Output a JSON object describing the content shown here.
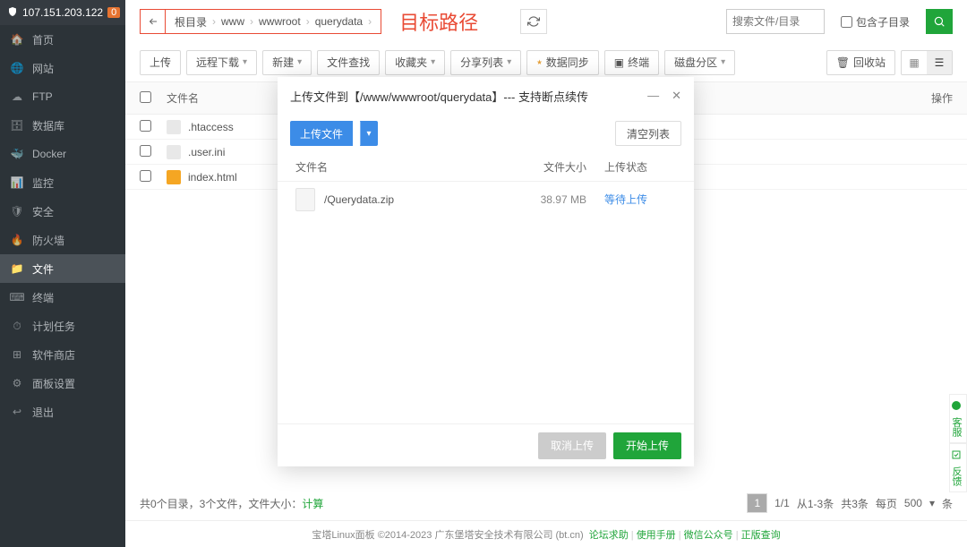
{
  "header": {
    "ip": "107.151.203.122",
    "badge": "0"
  },
  "sidebar": {
    "items": [
      {
        "label": "首页",
        "icon": "home-icon"
      },
      {
        "label": "网站",
        "icon": "globe-icon"
      },
      {
        "label": "FTP",
        "icon": "ftp-icon"
      },
      {
        "label": "数据库",
        "icon": "database-icon"
      },
      {
        "label": "Docker",
        "icon": "docker-icon"
      },
      {
        "label": "监控",
        "icon": "monitor-icon"
      },
      {
        "label": "安全",
        "icon": "shield-icon"
      },
      {
        "label": "防火墙",
        "icon": "firewall-icon"
      },
      {
        "label": "文件",
        "icon": "folder-icon"
      },
      {
        "label": "终端",
        "icon": "terminal-icon"
      },
      {
        "label": "计划任务",
        "icon": "schedule-icon"
      },
      {
        "label": "软件商店",
        "icon": "store-icon"
      },
      {
        "label": "面板设置",
        "icon": "settings-icon"
      },
      {
        "label": "退出",
        "icon": "exit-icon"
      }
    ],
    "active_index": 8
  },
  "breadcrumb": {
    "parts": [
      "根目录",
      "www",
      "wwwroot",
      "querydata"
    ]
  },
  "annotation": "目标路径",
  "search": {
    "placeholder": "搜索文件/目录",
    "checkbox_label": "包含子目录"
  },
  "toolbar": {
    "upload": "上传",
    "remote_download": "远程下载",
    "create": "新建",
    "file_search": "文件查找",
    "favorites": "收藏夹",
    "share_list": "分享列表",
    "data_sync": "数据同步",
    "terminal": "终端",
    "disk_partition": "磁盘分区",
    "recycle_bin": "回收站"
  },
  "table": {
    "header_name": "文件名",
    "header_ops": "操作",
    "rows": [
      {
        "name": ".htaccess",
        "kind": "file"
      },
      {
        "name": ".user.ini",
        "kind": "file"
      },
      {
        "name": "index.html",
        "kind": "html"
      }
    ]
  },
  "status": {
    "summary_prefix": "共0个目录，3个文件，文件大小：",
    "calc_label": "计算",
    "page_current": "1",
    "page_info": "1/1",
    "range": "从1-3条",
    "total": "共3条",
    "per_page_label": "每页",
    "per_page_value": "500",
    "suffix": "条"
  },
  "modal": {
    "title": "上传文件到【/www/wwwroot/querydata】--- 支持断点续传",
    "upload_btn": "上传文件",
    "clear_btn": "清空列表",
    "th_name": "文件名",
    "th_size": "文件大小",
    "th_status": "上传状态",
    "rows": [
      {
        "name": "/Querydata.zip",
        "size": "38.97 MB",
        "status": "等待上传"
      }
    ],
    "cancel": "取消上传",
    "start": "开始上传"
  },
  "footer": {
    "copyright": "宝塔Linux面板 ©2014-2023 广东堡塔安全技术有限公司 (bt.cn)",
    "links": [
      "论坛求助",
      "使用手册",
      "微信公众号",
      "正版查询"
    ]
  },
  "float": {
    "service": "客服",
    "feedback": "反馈"
  }
}
